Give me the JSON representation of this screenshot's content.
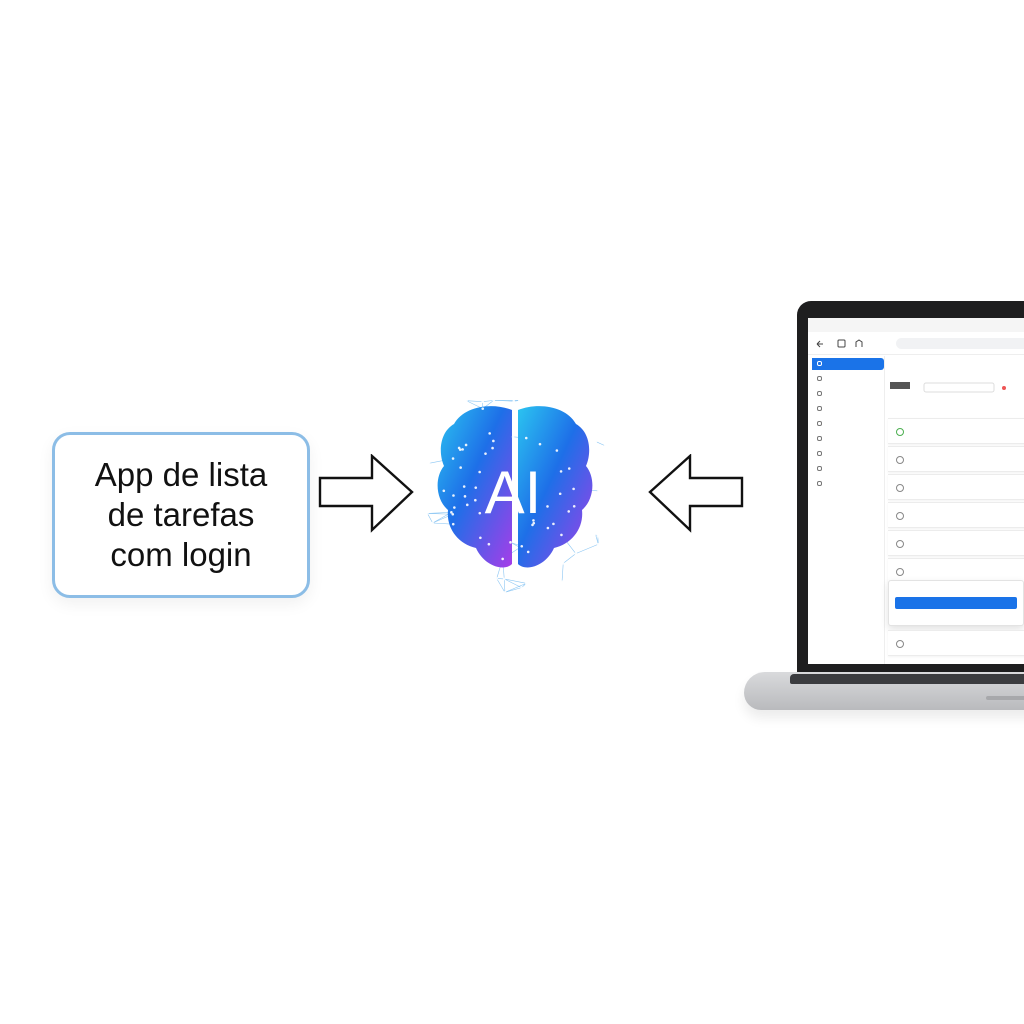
{
  "prompt": {
    "text": "App de lista\nde tarefas\ncom login"
  },
  "ai": {
    "label": "AI"
  },
  "colors": {
    "box_border": "#8cbde6",
    "brain_blue": "#1e6fe8",
    "brain_purple": "#9a3de8",
    "accent": "#1a73e8"
  },
  "icons": [
    "arrow-right-icon",
    "arrow-left-icon",
    "brain-icon",
    "laptop-icon"
  ]
}
